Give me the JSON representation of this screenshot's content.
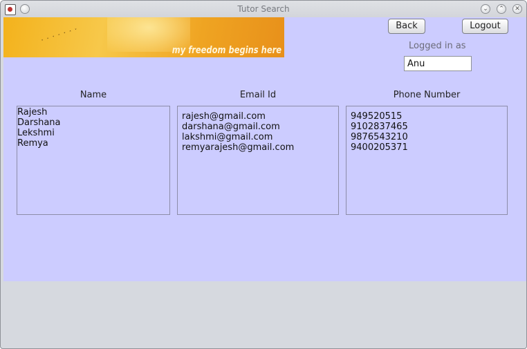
{
  "window": {
    "title": "Tutor Search"
  },
  "banner": {
    "tagline": "my freedom begins here"
  },
  "header": {
    "back_label": "Back",
    "logout_label": "Logout",
    "logged_in_label": "Logged in as",
    "username": "Anu"
  },
  "columns": {
    "name": "Name",
    "email": "Email Id",
    "phone": "Phone Number"
  },
  "names": [
    "Rajesh",
    "Darshana",
    "Lekshmi",
    "Remya"
  ],
  "emails": [
    "rajesh@gmail.com",
    "darshana@gmail.com",
    "lakshmi@gmail.com",
    "remyarajesh@gmail.com"
  ],
  "phones": [
    "949520515",
    "9102837465",
    "9876543210",
    "9400205371"
  ]
}
